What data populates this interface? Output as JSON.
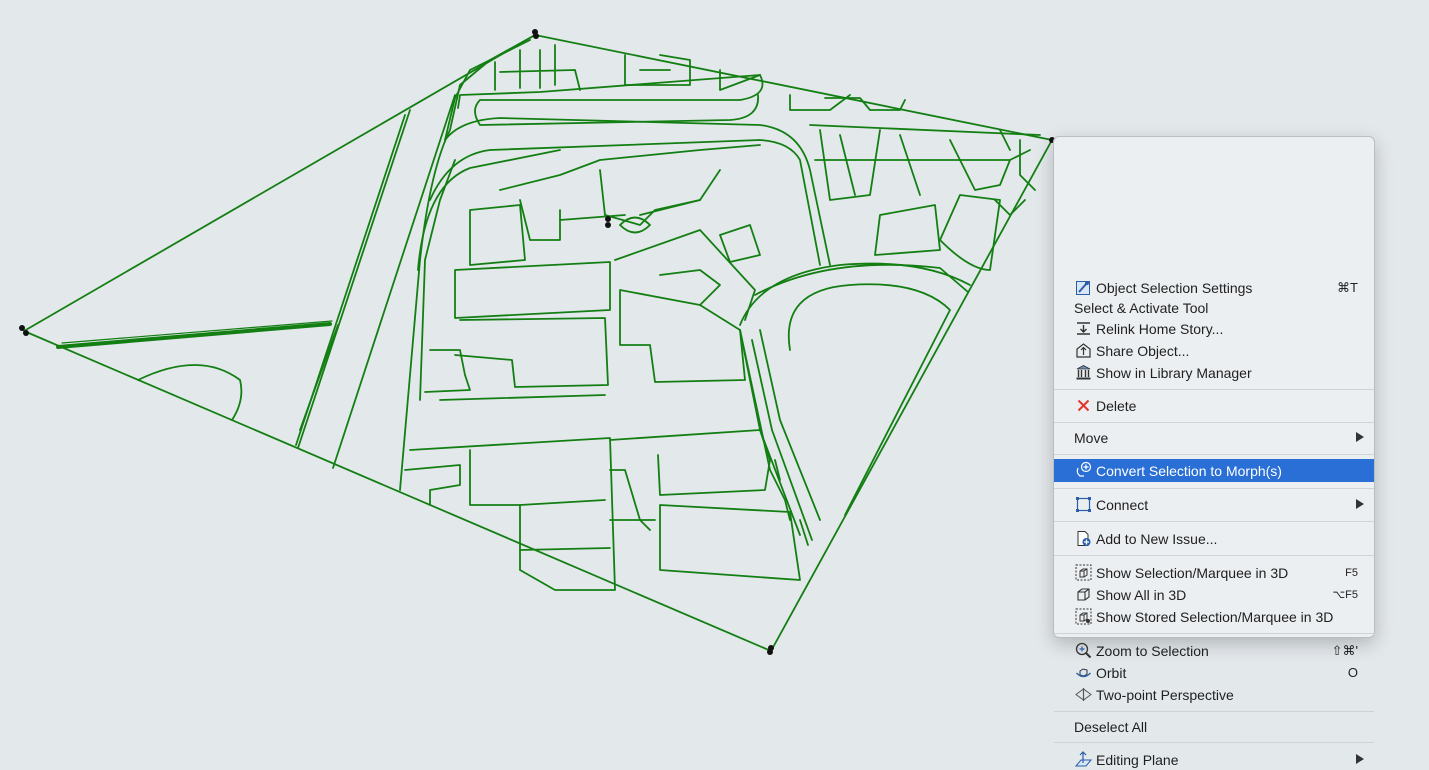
{
  "colors": {
    "background": "#e3e8eb",
    "drawing_lines": "#137f13",
    "menu_highlight": "#2a6fd6",
    "delete_icon": "#e5342a"
  },
  "context_menu": {
    "items": [
      {
        "icon": "object-settings-icon",
        "label": "Object Selection Settings",
        "shortcut": "⌘T"
      },
      {
        "label": "Select & Activate Tool"
      },
      {
        "icon": "relink-home-story-icon",
        "label": "Relink Home Story..."
      },
      {
        "icon": "share-object-icon",
        "label": "Share Object..."
      },
      {
        "icon": "library-manager-icon",
        "label": "Show in Library Manager"
      },
      {
        "icon": "delete-icon",
        "label": "Delete"
      },
      {
        "label": "Move",
        "submenu": true
      },
      {
        "icon": "morph-icon",
        "label": "Convert Selection to Morph(s)",
        "highlighted": true
      },
      {
        "icon": "connect-icon",
        "label": "Connect",
        "submenu": true
      },
      {
        "icon": "add-issue-icon",
        "label": "Add to New Issue..."
      },
      {
        "icon": "show-3d-icon",
        "label": "Show Selection/Marquee in 3D",
        "shortcut": "F5"
      },
      {
        "icon": "cube-icon",
        "label": "Show All in 3D",
        "shortcut": "⌥F5"
      },
      {
        "icon": "stored-3d-icon",
        "label": "Show Stored Selection/Marquee in 3D"
      },
      {
        "icon": "zoom-icon",
        "label": "Zoom to Selection",
        "shortcut": "⇧⌘'"
      },
      {
        "icon": "orbit-icon",
        "label": "Orbit",
        "shortcut": "O"
      },
      {
        "icon": "two-point-perspective-icon",
        "label": "Two-point Perspective"
      },
      {
        "label": "Deselect All"
      },
      {
        "icon": "editing-plane-icon",
        "label": "Editing Plane",
        "submenu": true
      }
    ]
  }
}
